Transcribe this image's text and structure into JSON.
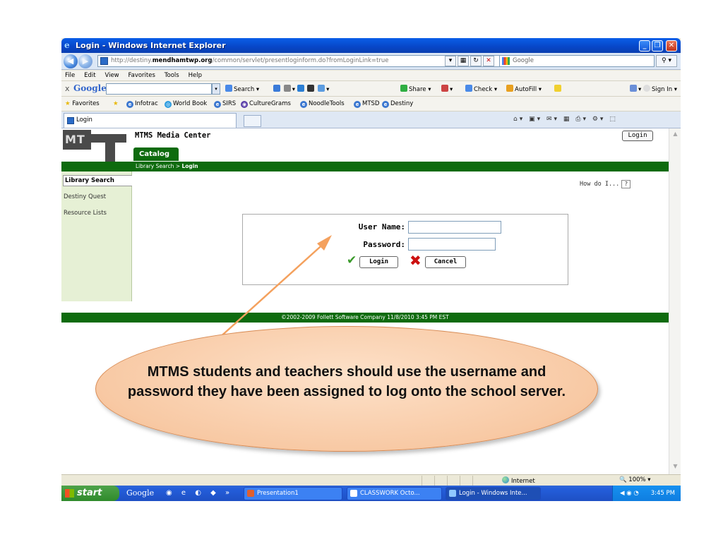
{
  "window": {
    "title": "Login - Windows Internet Explorer"
  },
  "address_bar": {
    "url_prefix": "http://destiny.",
    "url_domain": "mendhamtwp.org",
    "url_path": "/common/servlet/presentloginform.do?fromLoginLink=true",
    "search_placeholder": "Google"
  },
  "menu": [
    "File",
    "Edit",
    "View",
    "Favorites",
    "Tools",
    "Help"
  ],
  "google_toolbar": {
    "close": "x",
    "logo": "Google",
    "search_label": "Search",
    "share_label": "Share",
    "check_label": "Check",
    "autofill_label": "AutoFill",
    "signin_label": "Sign In"
  },
  "favorites_bar": {
    "favorites_label": "Favorites",
    "links": [
      "Infotrac",
      "World Book",
      "SIRS",
      "CultureGrams",
      "NoodleTools",
      "MTSD",
      "Destiny"
    ]
  },
  "tab": {
    "label": "Login"
  },
  "site": {
    "logo_text": "MT",
    "title": "MTMS Media Center",
    "catalog_tab": "Catalog",
    "breadcrumb_prefix": "Library Search > ",
    "breadcrumb_current": "Login",
    "top_login_button": "Login",
    "how_do_i": "How do I...",
    "help_icon": "?"
  },
  "sidebar": {
    "items": [
      "Library Search",
      "Destiny Quest",
      "Resource Lists"
    ]
  },
  "login_form": {
    "username_label": "User Name:",
    "username_value": "",
    "password_label": "Password:",
    "password_value": "",
    "login_button": "Login",
    "cancel_button": "Cancel"
  },
  "footer": {
    "text": "©2002-2009  Follett Software Company    11/8/2010 3:45 PM EST"
  },
  "status_bar": {
    "zone": "Internet",
    "zoom": "100%"
  },
  "taskbar": {
    "start_label": "start",
    "google_label": "Google",
    "tasks": [
      "Presentation1",
      "CLASSWORK    Octo...",
      "Login - Windows Inte..."
    ],
    "time": "3:45 PM"
  },
  "callout": {
    "text": "MTMS students and teachers should use the username and password they have been assigned to log onto the school server."
  },
  "colors": {
    "header_green": "#0e6b0e",
    "callout_fill": "#f8c9a4",
    "arrow": "#f4a15e",
    "title_blue": "#0a5ee8"
  }
}
